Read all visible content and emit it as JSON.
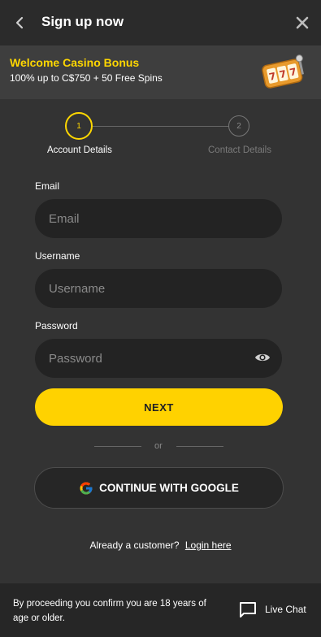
{
  "header": {
    "title": "Sign up now",
    "back_icon": "chevron-left-icon",
    "close_icon": "close-icon"
  },
  "bonus": {
    "title": "Welcome Casino Bonus",
    "subtitle": "100% up to C$750 + 50 Free Spins",
    "icon": "slot-machine-icon"
  },
  "stepper": {
    "steps": [
      {
        "number": "1",
        "label": "Account Details",
        "active": true
      },
      {
        "number": "2",
        "label": "Contact Details",
        "active": false
      }
    ]
  },
  "form": {
    "email": {
      "label": "Email",
      "placeholder": "Email",
      "value": ""
    },
    "username": {
      "label": "Username",
      "placeholder": "Username",
      "value": ""
    },
    "password": {
      "label": "Password",
      "placeholder": "Password",
      "value": "",
      "toggle_icon": "eye-icon"
    },
    "next_label": "NEXT",
    "or_text": "or",
    "google_label": "CONTINUE WITH GOOGLE"
  },
  "login": {
    "prompt": "Already a customer?",
    "link": "Login here"
  },
  "footer": {
    "text": "By proceeding you confirm you are 18 years of age or older.",
    "chat_label": "Live Chat",
    "chat_icon": "chat-bubble-icon"
  },
  "colors": {
    "accent": "#ffd200",
    "background": "#333333",
    "header": "#2b2b2b",
    "input": "#232323"
  }
}
